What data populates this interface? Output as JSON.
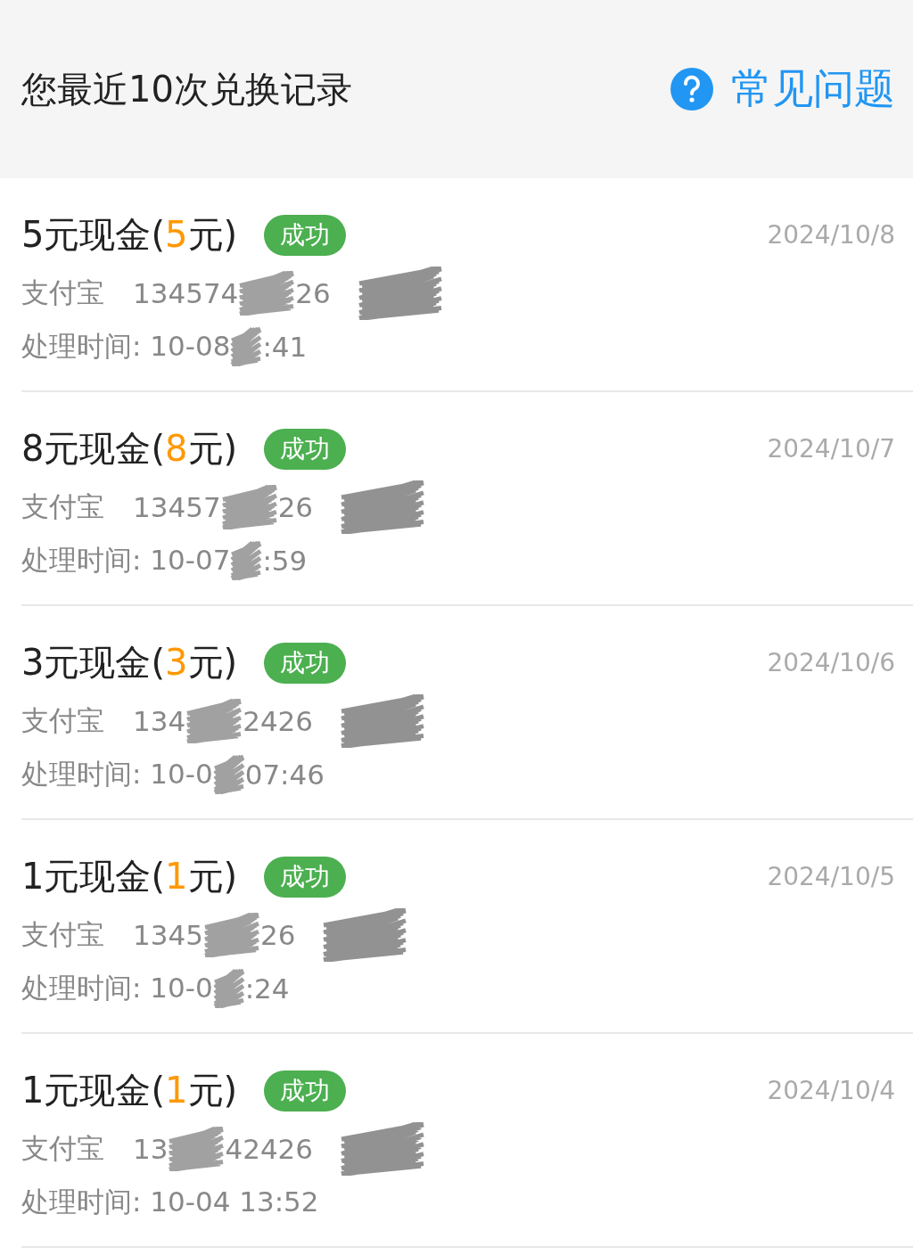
{
  "header": {
    "title": "您最近10次兑换记录",
    "help_link": "常见问题"
  },
  "records": [
    {
      "title_parts": [
        "5元现金(",
        "5",
        "元)"
      ],
      "status": "成功",
      "date": "2024/10/8",
      "method": "支付宝",
      "account_parts": [
        "134574",
        "26"
      ],
      "time_parts": [
        "处理时间: 10-08",
        ":41"
      ]
    },
    {
      "title_parts": [
        "8元现金(",
        "8",
        "元)"
      ],
      "status": "成功",
      "date": "2024/10/7",
      "method": "支付宝",
      "account_parts": [
        "13457",
        "26"
      ],
      "time_parts": [
        "处理时间: 10-07",
        ":59"
      ]
    },
    {
      "title_parts": [
        "3元现金(",
        "3",
        "元)"
      ],
      "status": "成功",
      "date": "2024/10/6",
      "method": "支付宝",
      "account_parts": [
        "134",
        "2426"
      ],
      "time_parts": [
        "处理时间: 10-0",
        "07:46"
      ]
    },
    {
      "title_parts": [
        "1元现金(",
        "1",
        "元)"
      ],
      "status": "成功",
      "date": "2024/10/5",
      "method": "支付宝",
      "account_parts": [
        "1345",
        "26"
      ],
      "time_parts": [
        "处理时间: 10-0",
        ":24"
      ]
    },
    {
      "title_parts": [
        "1元现金(",
        "1",
        "元)"
      ],
      "status": "成功",
      "date": "2024/10/4",
      "method": "支付宝",
      "account_parts": [
        "13",
        "42426"
      ],
      "time_parts": [
        "处理时间: 10-04 13:52"
      ]
    }
  ]
}
